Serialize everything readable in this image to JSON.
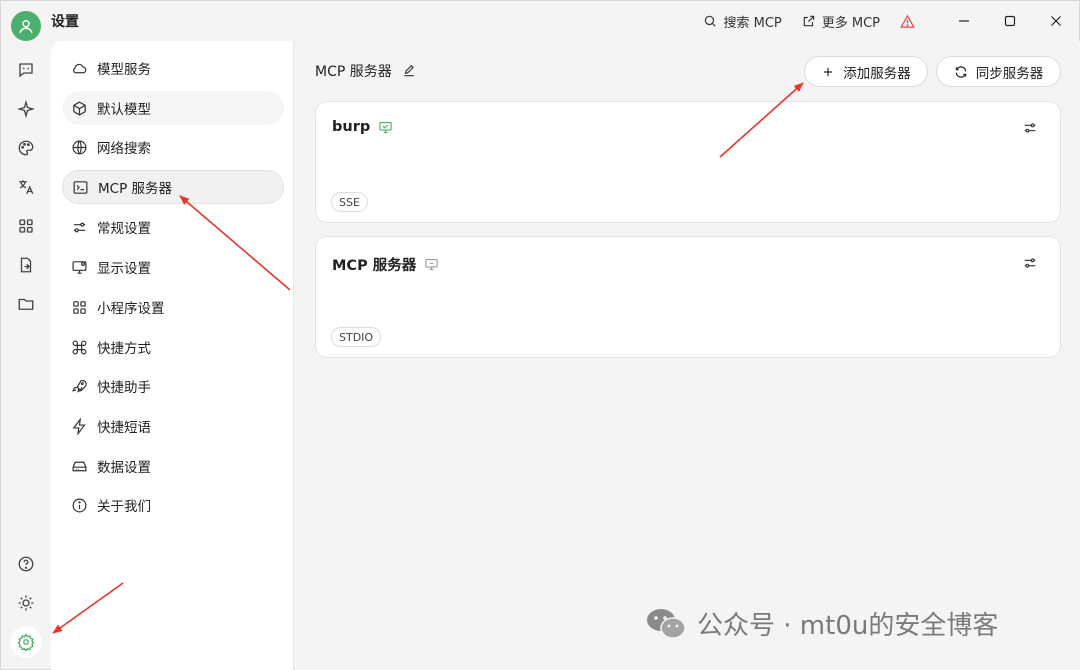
{
  "app": {
    "title": "设置"
  },
  "titlebar": {
    "search_mcp": "搜索 MCP",
    "more_mcp": "更多 MCP"
  },
  "rail": {
    "icons": [
      "chat-icon",
      "sparkle-icon",
      "palette-icon",
      "translate-icon",
      "apps-grid-icon",
      "file-export-icon",
      "folder-icon",
      "help-icon",
      "sun-icon",
      "settings-gear-icon"
    ]
  },
  "nav": {
    "items": [
      {
        "label": "模型服务",
        "icon": "cloud-icon"
      },
      {
        "label": "默认模型",
        "icon": "cube-icon"
      },
      {
        "label": "网络搜索",
        "icon": "globe-icon"
      },
      {
        "label": "MCP 服务器",
        "icon": "terminal-icon"
      },
      {
        "label": "常规设置",
        "icon": "sliders-icon"
      },
      {
        "label": "显示设置",
        "icon": "monitor-icon"
      },
      {
        "label": "小程序设置",
        "icon": "grid-icon"
      },
      {
        "label": "快捷方式",
        "icon": "command-icon"
      },
      {
        "label": "快捷助手",
        "icon": "rocket-icon"
      },
      {
        "label": "快捷短语",
        "icon": "lightning-icon"
      },
      {
        "label": "数据设置",
        "icon": "drive-icon"
      },
      {
        "label": "关于我们",
        "icon": "info-icon"
      }
    ],
    "active_index": 3
  },
  "main": {
    "title": "MCP 服务器",
    "add_server": "添加服务器",
    "sync_server": "同步服务器",
    "servers": [
      {
        "name": "burp",
        "type": "SSE",
        "status_color": "#4caf6e"
      },
      {
        "name": "MCP 服务器",
        "type": "STDIO",
        "status_color": "#9a9a9a"
      }
    ]
  },
  "watermark": {
    "text": "公众号 · mt0u的安全博客"
  },
  "colors": {
    "accent": "#4caf6e",
    "warning": "#e04a3f",
    "arrow": "#e8352a"
  }
}
